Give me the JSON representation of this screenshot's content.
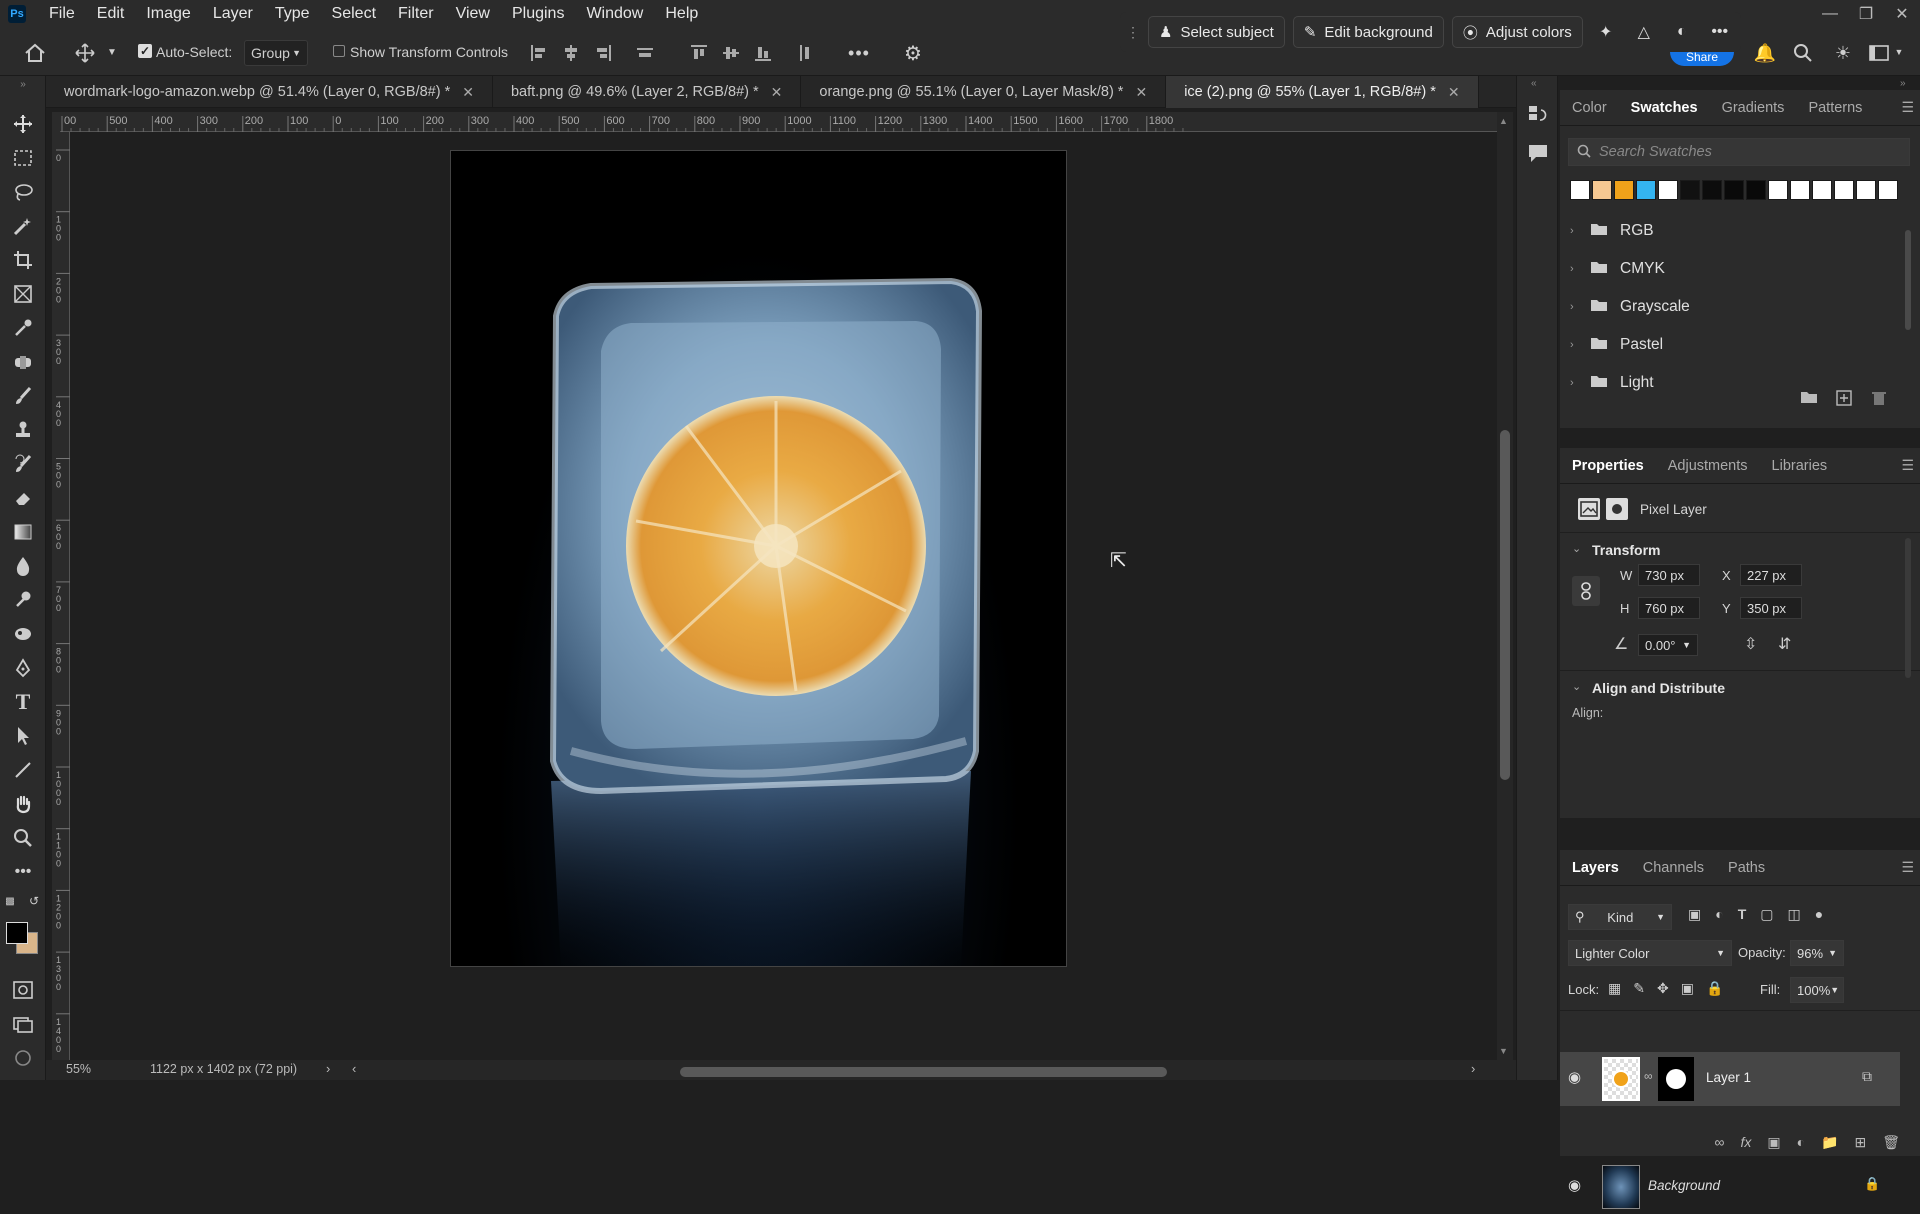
{
  "menubar": {
    "logo": "Ps",
    "items": [
      "File",
      "Edit",
      "Image",
      "Layer",
      "Type",
      "Select",
      "Filter",
      "View",
      "Plugins",
      "Window",
      "Help"
    ]
  },
  "contextual_taskbar": {
    "select_subject": "Select subject",
    "edit_background": "Edit background",
    "adjust_colors": "Adjust colors"
  },
  "options_bar": {
    "auto_select_label": "Auto-Select:",
    "auto_select_checked": true,
    "auto_select_target": "Group",
    "show_transform_label": "Show Transform Controls",
    "show_transform_checked": false,
    "share_label": "Share"
  },
  "tabs": [
    {
      "label": "wordmark-logo-amazon.webp @ 51.4% (Layer 0, RGB/8#) *",
      "active": false
    },
    {
      "label": "baft.png @ 49.6% (Layer 2, RGB/8#) *",
      "active": false
    },
    {
      "label": "orange.png @ 55.1% (Layer 0, Layer Mask/8) *",
      "active": false
    },
    {
      "label": "ice (2).png @ 55% (Layer 1, RGB/8#) *",
      "active": true
    }
  ],
  "ruler": {
    "h_labels": [
      "00",
      "500",
      "400",
      "300",
      "200",
      "100",
      "0",
      "100",
      "200",
      "300",
      "400",
      "500",
      "600",
      "700",
      "800",
      "900",
      "1000",
      "1100",
      "1200",
      "1300",
      "1400",
      "1500",
      "1600",
      "1700",
      "1800"
    ],
    "v_labels": [
      "0",
      "1\n0\n0",
      "2\n0\n0",
      "3\n0\n0",
      "4\n0\n0",
      "5\n0\n0",
      "6\n0\n0",
      "7\n0\n0",
      "8\n0\n0",
      "9\n0\n0",
      "1\n0\n0\n0",
      "1\n1\n0\n0",
      "1\n2\n0\n0",
      "1\n3\n0\n0",
      "1\n4\n0\n0"
    ]
  },
  "status": {
    "zoom": "55%",
    "doc_info": "1122 px x 1402 px (72 ppi)"
  },
  "swatches_panel": {
    "tabs": [
      "Color",
      "Swatches",
      "Gradients",
      "Patterns"
    ],
    "active_tab": "Swatches",
    "search_placeholder": "Search Swatches",
    "recent_colors": [
      "#ffffff",
      "#f5c892",
      "#f0a21a",
      "#34b4f0",
      "#ffffff",
      "#111111",
      "#0c0c0c",
      "#0a0a0a",
      "#090909",
      "#ffffff",
      "#ffffff",
      "#ffffff",
      "#ffffff",
      "#ffffff",
      "#ffffff"
    ],
    "folders": [
      "RGB",
      "CMYK",
      "Grayscale",
      "Pastel",
      "Light"
    ]
  },
  "properties_panel": {
    "tabs": [
      "Properties",
      "Adjustments",
      "Libraries"
    ],
    "active_tab": "Properties",
    "layer_type": "Pixel Layer",
    "transform_title": "Transform",
    "w_label": "W",
    "w_value": "730 px",
    "h_label": "H",
    "h_value": "760 px",
    "x_label": "X",
    "x_value": "227 px",
    "y_label": "Y",
    "y_value": "350 px",
    "angle_value": "0.00°",
    "align_title": "Align and Distribute",
    "align_label": "Align:"
  },
  "layers_panel": {
    "tabs": [
      "Layers",
      "Channels",
      "Paths"
    ],
    "active_tab": "Layers",
    "filter_kind": "Kind",
    "blend_mode": "Lighter Color",
    "opacity_label": "Opacity:",
    "opacity_value": "96%",
    "lock_label": "Lock:",
    "fill_label": "Fill:",
    "fill_value": "100%",
    "layers": [
      {
        "name": "Layer 1",
        "visible": true,
        "selected": true
      },
      {
        "name": "Background",
        "visible": true,
        "selected": false
      }
    ]
  },
  "colors": {
    "accent": "#1473e6",
    "panel_bg": "#2b2b2b",
    "canvas_bg": "#1f1f1f"
  }
}
